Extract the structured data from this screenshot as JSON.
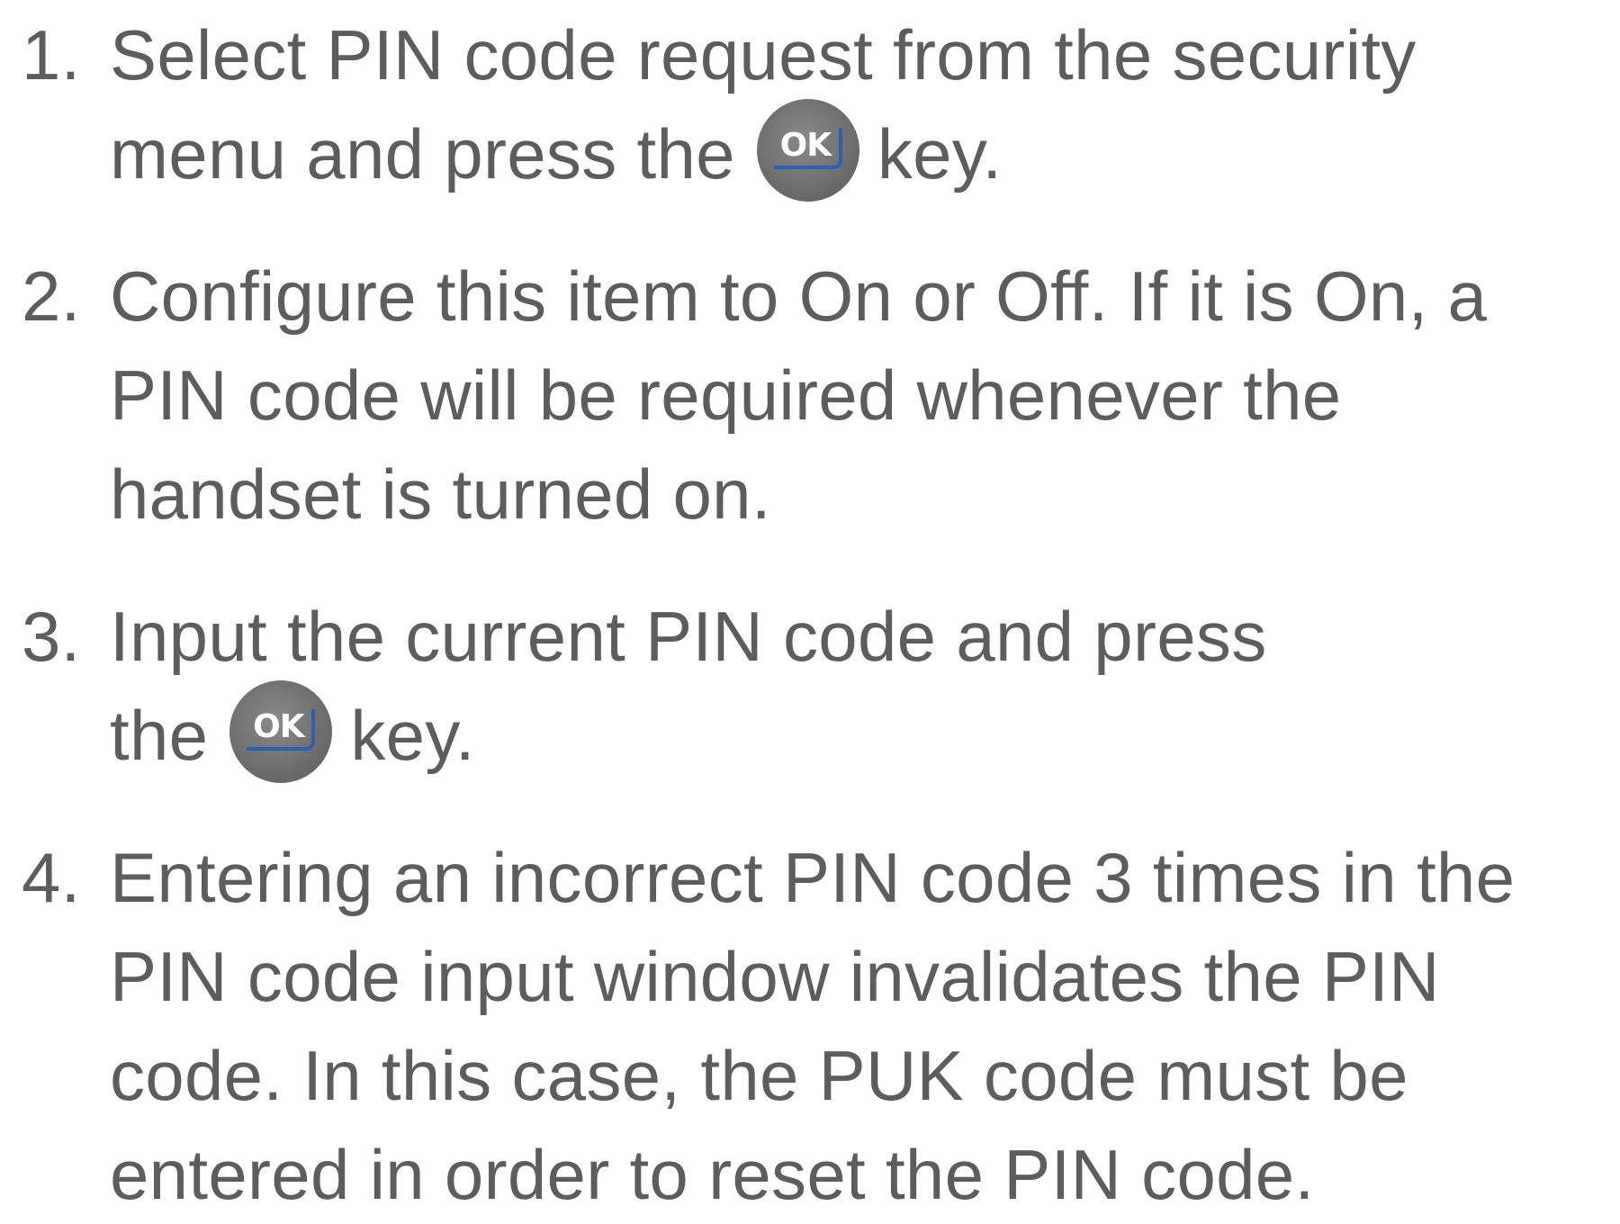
{
  "steps": [
    {
      "number": "1.",
      "line1": "Select PIN code request from the security",
      "line2_before": "menu and press the",
      "key_label": "OK",
      "line2_after": "key."
    },
    {
      "number": "2.",
      "line1": "Configure this item to On or Off. If it is On, a",
      "line2": "PIN code will be required whenever the",
      "line3": "handset is turned on."
    },
    {
      "number": "3.",
      "line1": "Input the current PIN code and press",
      "line2_before": "the",
      "key_label": "OK",
      "line2_after": "key."
    },
    {
      "number": "4.",
      "line1": "Entering an incorrect PIN code 3 times in the",
      "line2": "PIN code input window invalidates the PIN",
      "line3": "code. In this case, the PUK code must be",
      "line4": "entered in order to reset the PIN code."
    }
  ],
  "icons": {
    "ok_key": "ok-key-icon"
  },
  "colors": {
    "text": "#5d5d5d",
    "key_fill": "#707070",
    "key_accent": "#2f5fb2"
  }
}
